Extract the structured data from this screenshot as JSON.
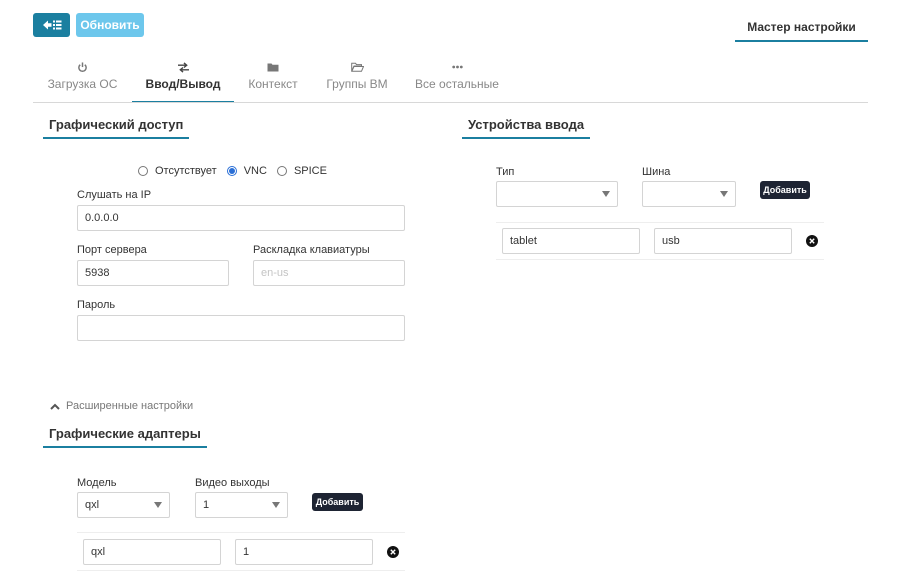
{
  "toolbar": {
    "refresh_label": "Обновить",
    "wizard_label": "Мастер настройки"
  },
  "tabs": [
    {
      "label": "Загрузка ОС",
      "icon": "power-icon"
    },
    {
      "label": "Ввод/Вывод",
      "icon": "exchange-icon"
    },
    {
      "label": "Контекст",
      "icon": "folder-icon"
    },
    {
      "label": "Группы ВМ",
      "icon": "folder-open-icon"
    },
    {
      "label": "Все остальные",
      "icon": "ellipsis-icon"
    }
  ],
  "graphics": {
    "title": "Графический доступ",
    "radio": [
      "Отсутствует",
      "VNC",
      "SPICE"
    ],
    "selected": "VNC",
    "listen_label": "Слушать на IP",
    "listen_value": "0.0.0.0",
    "port_label": "Порт сервера",
    "port_value": "5938",
    "keymap_label": "Раскладка клавиатуры",
    "keymap_placeholder": "en-us",
    "password_label": "Пароль",
    "password_value": ""
  },
  "advanced": {
    "label": "Расширенные настройки"
  },
  "adapters": {
    "title": "Графические адаптеры",
    "model_label": "Модель",
    "model_value": "qxl",
    "outputs_label": "Видео выходы",
    "outputs_value": "1",
    "add_label": "Добавить",
    "row": {
      "model": "qxl",
      "outputs": "1"
    }
  },
  "input_devices": {
    "title": "Устройства ввода",
    "type_label": "Тип",
    "type_value": "",
    "bus_label": "Шина",
    "bus_value": "",
    "add_label": "Добавить",
    "row": {
      "type": "tablet",
      "bus": "usb"
    }
  },
  "colors": {
    "accent": "#1b7fa0",
    "refresh": "#6dc7ec",
    "dark_button": "#1e2433",
    "radio": "#2a6fd6"
  }
}
